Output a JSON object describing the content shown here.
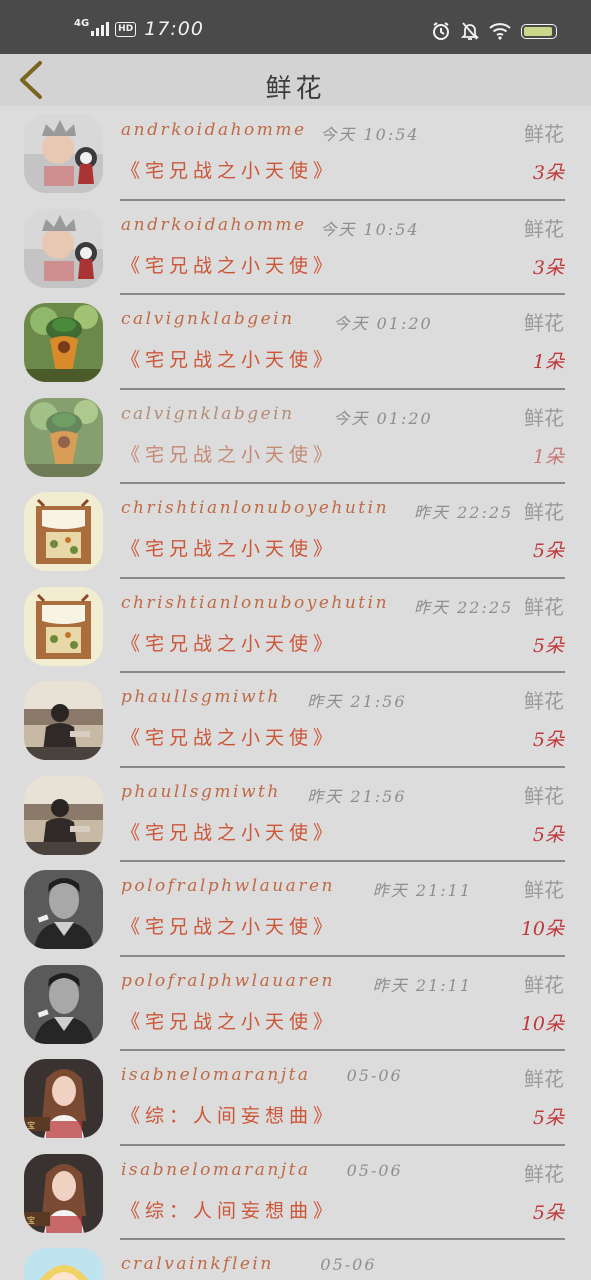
{
  "status_bar": {
    "network": "4G",
    "hd": "HD",
    "time": "17:00",
    "battery_color": "#c9d989",
    "icons": [
      "alarm-icon",
      "mute-bell-icon",
      "wifi-icon"
    ]
  },
  "header": {
    "title": "鲜花",
    "back_icon": "chevron-left-icon"
  },
  "colors": {
    "name": "#c06a45",
    "book": "#cc5638",
    "count": "#c0383c"
  },
  "records": [
    {
      "user": "andrkoidahomme",
      "time": "今天 10:54",
      "type": "鲜花",
      "book": "《宅兄战之小天使》",
      "count": "3朵",
      "avatar": "baby-with-crown"
    },
    {
      "user": "andrkoidahomme",
      "time": "今天 10:54",
      "type": "鲜花",
      "book": "《宅兄战之小天使》",
      "count": "3朵",
      "avatar": "baby-with-crown"
    },
    {
      "user": "calvignklabgein",
      "time": "今天 01:20",
      "type": "鲜花",
      "book": "《宅兄战之小天使》",
      "count": "1朵",
      "avatar": "plant-zombie"
    },
    {
      "user": "calvignklabgein",
      "time": "今天 01:20",
      "type": "鲜花",
      "book": "《宅兄战之小天使》",
      "count": "1朵",
      "avatar": "plant-zombie",
      "faded": true
    },
    {
      "user": "chrishtianlonuboyehutin",
      "time": "昨天 22:25",
      "type": "鲜花",
      "book": "《宅兄战之小天使》",
      "count": "5朵",
      "avatar": "drawing-board"
    },
    {
      "user": "chrishtianlonuboyehutin",
      "time": "昨天 22:25",
      "type": "鲜花",
      "book": "《宅兄战之小天使》",
      "count": "5朵",
      "avatar": "drawing-board"
    },
    {
      "user": "phaullsgmiwth",
      "time": "昨天 21:56",
      "type": "鲜花",
      "book": "《宅兄战之小天使》",
      "count": "5朵",
      "avatar": "man-on-rooftop"
    },
    {
      "user": "phaullsgmiwth",
      "time": "昨天 21:56",
      "type": "鲜花",
      "book": "《宅兄战之小天使》",
      "count": "5朵",
      "avatar": "man-on-rooftop"
    },
    {
      "user": "polofralphwlauaren",
      "time": "昨天 21:11",
      "type": "鲜花",
      "book": "《宅兄战之小天使》",
      "count": "10朵",
      "avatar": "man-portrait"
    },
    {
      "user": "polofralphwlauaren",
      "time": "昨天 21:11",
      "type": "鲜花",
      "book": "《宅兄战之小天使》",
      "count": "10朵",
      "avatar": "man-portrait"
    },
    {
      "user": "isabnelomaranjta",
      "time": "05-06",
      "type": "鲜花",
      "book": "《综：人间妄想曲》",
      "count": "5朵",
      "avatar": "woman-portrait"
    },
    {
      "user": "isabnelomaranjta",
      "time": "05-06",
      "type": "鲜花",
      "book": "《综：人间妄想曲》",
      "count": "5朵",
      "avatar": "woman-portrait"
    },
    {
      "user": "cralvainkflein",
      "time": "05-06",
      "type": "",
      "book": "",
      "count": "",
      "avatar": "anime-girl"
    }
  ]
}
